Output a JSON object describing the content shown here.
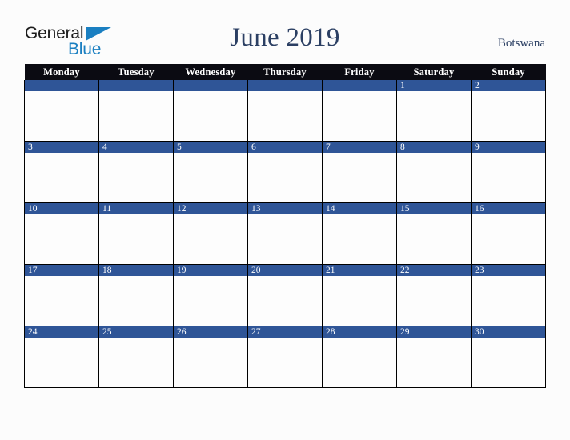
{
  "brand": {
    "line1": "General",
    "line2": "Blue",
    "triangle_color": "#1a7fc1",
    "line1_color": "#1c1c1c",
    "line2_color": "#1a7fc1"
  },
  "header": {
    "title": "June 2019",
    "country": "Botswana",
    "title_color": "#2b3f63"
  },
  "calendar": {
    "month": "June",
    "year": "2019",
    "weekday_headers": [
      "Monday",
      "Tuesday",
      "Wednesday",
      "Thursday",
      "Friday",
      "Saturday",
      "Sunday"
    ],
    "header_bg": "#0b0b12",
    "header_fg": "#ffffff",
    "daynum_bg": "#2f5597",
    "daynum_fg": "#ffffff",
    "cell_bg": "#fdfdfd",
    "border_color": "#000000",
    "weeks": [
      [
        "",
        "",
        "",
        "",
        "",
        "1",
        "2"
      ],
      [
        "3",
        "4",
        "5",
        "6",
        "7",
        "8",
        "9"
      ],
      [
        "10",
        "11",
        "12",
        "13",
        "14",
        "15",
        "16"
      ],
      [
        "17",
        "18",
        "19",
        "20",
        "21",
        "22",
        "23"
      ],
      [
        "24",
        "25",
        "26",
        "27",
        "28",
        "29",
        "30"
      ]
    ]
  },
  "page": {
    "background": "#fcfcfc"
  }
}
